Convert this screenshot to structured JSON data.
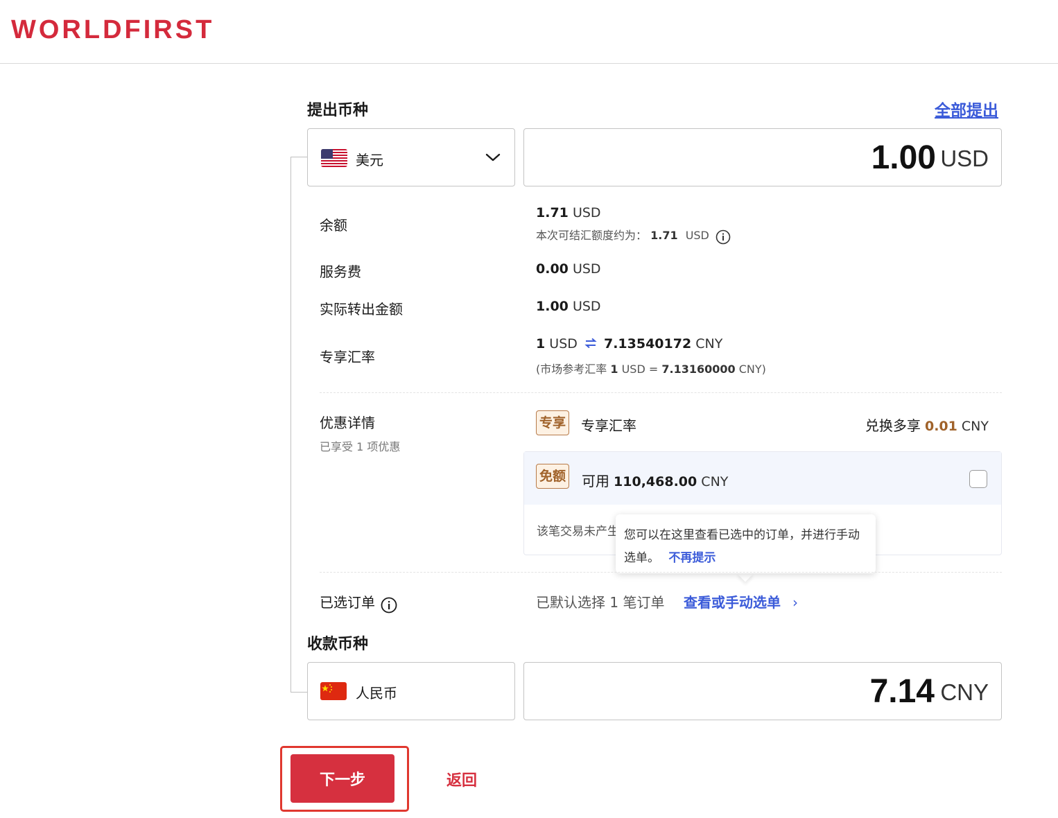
{
  "header": {
    "logo_text": "WORLDFIRST",
    "brand_color": "#d42a3c"
  },
  "withdraw": {
    "section_title": "提出币种",
    "withdraw_all_label": "全部提出",
    "currency_name": "美元",
    "currency_icon": "us-flag-icon",
    "amount_value": "1.00",
    "amount_currency": "USD"
  },
  "details": {
    "balance_label": "余额",
    "balance_value": "1.71",
    "balance_unit": "USD",
    "available_prefix": "本次可结汇额度约为：",
    "available_value": "1.71",
    "available_unit": "USD",
    "fee_label": "服务费",
    "fee_value": "0.00",
    "fee_unit": "USD",
    "actual_label": "实际转出金额",
    "actual_value": "1.00",
    "actual_unit": "USD",
    "rate_label": "专享汇率",
    "rate_from_num": "1",
    "rate_from_unit": "USD",
    "rate_to_value": "7.13540172",
    "rate_to_unit": "CNY",
    "market_prefix": "(市场参考汇率",
    "market_from_num": "1",
    "market_from_unit": "USD",
    "market_eq": "=",
    "market_value": "7.13160000",
    "market_unit": "CNY)"
  },
  "promo": {
    "label": "优惠详情",
    "sub_label": "已享受 1 项优惠",
    "tag_exclusive": "专享",
    "exclusive_title": "专享汇率",
    "extra_prefix": "兑换多享",
    "extra_value": "0.01",
    "extra_unit": "CNY",
    "tag_free": "免额",
    "free_prefix": "可用",
    "free_value": "110,468.00",
    "free_unit": "CNY",
    "free_note": "该笔交易未产生"
  },
  "tooltip": {
    "text": "您可以在这里查看已选中的订单，并进行手动选单。",
    "dismiss_label": "不再提示"
  },
  "orders": {
    "label": "已选订单",
    "status_text": "已默认选择 1 笔订单",
    "view_link": "查看或手动选单",
    "chevron": "›"
  },
  "receive": {
    "section_title": "收款币种",
    "currency_name": "人民币",
    "currency_icon": "cn-flag-icon",
    "amount_value": "7.14",
    "amount_currency": "CNY"
  },
  "actions": {
    "next_label": "下一步",
    "back_label": "返回"
  }
}
